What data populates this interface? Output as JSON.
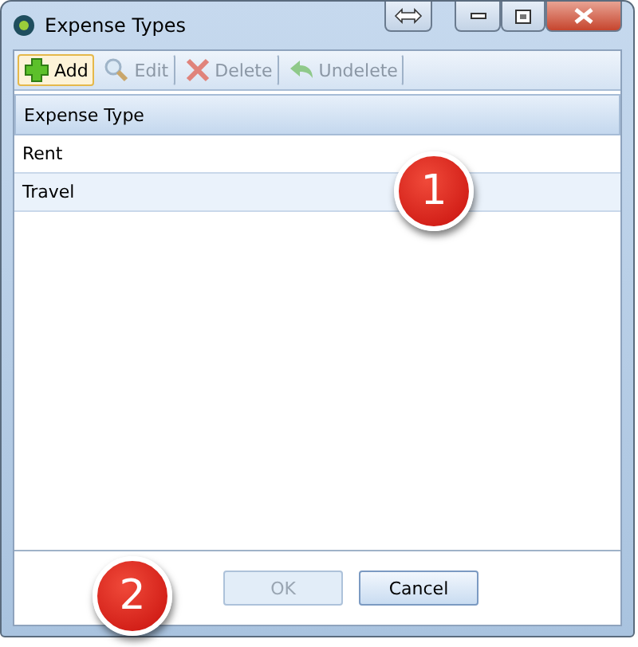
{
  "window": {
    "title": "Expense Types"
  },
  "toolbar": [
    {
      "kind": "add",
      "label": "Add",
      "disabled": false,
      "focused": true
    },
    {
      "kind": "edit",
      "label": "Edit",
      "disabled": true,
      "focused": false
    },
    {
      "kind": "delete",
      "label": "Delete",
      "disabled": true,
      "focused": false
    },
    {
      "kind": "undelete",
      "label": "Undelete",
      "disabled": true,
      "focused": false
    }
  ],
  "table": {
    "columns": [
      "Expense Type"
    ],
    "rows": [
      {
        "cells": [
          "Rent"
        ],
        "selected": false
      },
      {
        "cells": [
          "Travel"
        ],
        "selected": true
      }
    ]
  },
  "buttons": [
    {
      "label": "OK",
      "disabled": true
    },
    {
      "label": "Cancel",
      "disabled": false
    }
  ],
  "callouts": [
    "1",
    "2"
  ]
}
